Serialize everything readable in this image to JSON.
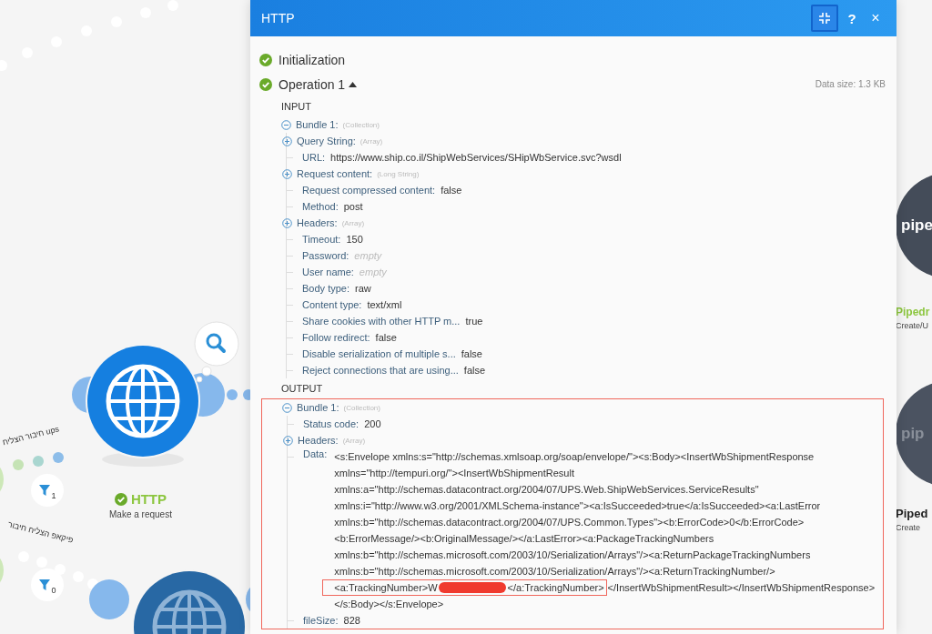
{
  "canvas": {
    "http_node": {
      "title": "HTTP",
      "subtitle": "Make a request",
      "ok": true
    },
    "filters": [
      {
        "count": "1",
        "label": "חיבור הצליח ups"
      },
      {
        "count": "0",
        "label": "פיקאפ הצליח חיבור"
      }
    ],
    "side_nodes": [
      {
        "logo": "pipe",
        "title": "Pipedr",
        "subtitle": "Create/U",
        "ok": true
      },
      {
        "logo": "pip",
        "title": "Piped",
        "subtitle": "Create",
        "ok": false
      }
    ]
  },
  "panel": {
    "title": "HTTP",
    "buttons": [
      {
        "kind": "shrink",
        "selected": true
      },
      {
        "kind": "help",
        "label": "?"
      },
      {
        "kind": "close",
        "label": "×"
      }
    ],
    "sections": [
      {
        "title": "Initialization",
        "ok": true
      },
      {
        "title": "Operation 1",
        "ok": true,
        "expanded": true,
        "data_size": "Data size: 1.3 KB",
        "groups": [
          {
            "title": "INPUT",
            "bundle": {
              "label": "Bundle 1:",
              "hint": "(Collection)",
              "expanded": true,
              "rows": [
                {
                  "kind": "expand",
                  "label": "Query String:",
                  "hint": "(Array)",
                  "expanded": false
                },
                {
                  "kind": "field",
                  "label": "URL:",
                  "value": "https://www.ship.co.il/ShipWebServices/SHipWbService.svc?wsdl"
                },
                {
                  "kind": "expand",
                  "label": "Request content:",
                  "hint": "(Long String)",
                  "expanded": false
                },
                {
                  "kind": "field",
                  "label": "Request compressed content:",
                  "value": "false"
                },
                {
                  "kind": "field",
                  "label": "Method:",
                  "value": "post"
                },
                {
                  "kind": "expand",
                  "label": "Headers:",
                  "hint": "(Array)",
                  "expanded": false
                },
                {
                  "kind": "field",
                  "label": "Timeout:",
                  "value": "150"
                },
                {
                  "kind": "field",
                  "label": "Password:",
                  "value": "empty",
                  "is_empty": true
                },
                {
                  "kind": "field",
                  "label": "User name:",
                  "value": "empty",
                  "is_empty": true
                },
                {
                  "kind": "field",
                  "label": "Body type:",
                  "value": "raw"
                },
                {
                  "kind": "field",
                  "label": "Content type:",
                  "value": "text/xml"
                },
                {
                  "kind": "field",
                  "label": "Share cookies with other HTTP m...",
                  "value": "true"
                },
                {
                  "kind": "field",
                  "label": "Follow redirect:",
                  "value": "false"
                },
                {
                  "kind": "field",
                  "label": "Disable serialization of multiple s...",
                  "value": "false"
                },
                {
                  "kind": "field",
                  "label": "Reject connections that are using...",
                  "value": "false"
                }
              ]
            }
          },
          {
            "title": "OUTPUT",
            "bundle": {
              "label": "Bundle 1:",
              "hint": "(Collection)",
              "expanded": true,
              "highlighted": true,
              "rows": [
                {
                  "kind": "field",
                  "label": "Status code:",
                  "value": "200"
                },
                {
                  "kind": "expand",
                  "label": "Headers:",
                  "hint": "(Array)",
                  "expanded": false
                },
                {
                  "kind": "multiline",
                  "label": "Data:",
                  "lines": [
                    {
                      "text": "<s:Envelope xmlns:s=\"http://schemas.xmlsoap.org/soap/envelope/\"><s:Body><InsertWbShipmentResponse"
                    },
                    {
                      "text": "xmlns=\"http://tempuri.org/\"><InsertWbShipmentResult"
                    },
                    {
                      "text": "xmlns:a=\"http://schemas.datacontract.org/2004/07/UPS.Web.ShipWebServices.ServiceResults\""
                    },
                    {
                      "text": "xmlns:i=\"http://www.w3.org/2001/XMLSchema-instance\"><a:IsSucceeded>true</a:IsSucceeded><a:LastError"
                    },
                    {
                      "text": "xmlns:b=\"http://schemas.datacontract.org/2004/07/UPS.Common.Types\"><b:ErrorCode>0</b:ErrorCode>"
                    },
                    {
                      "text": "<b:ErrorMessage/><b:OriginalMessage/></a:LastError><a:PackageTrackingNumbers"
                    },
                    {
                      "text": "xmlns:b=\"http://schemas.microsoft.com/2003/10/Serialization/Arrays\"/><a:ReturnPackageTrackingNumbers"
                    },
                    {
                      "text": "xmlns:b=\"http://schemas.microsoft.com/2003/10/Serialization/Arrays\"/><a:ReturnTrackingNumber/>"
                    },
                    {
                      "highlighted": true,
                      "before": "<a:TrackingNumber>W",
                      "redacted": true,
                      "after": "</a:TrackingNumber>",
                      "text": "</InsertWbShipmentResult></InsertWbShipmentResponse>"
                    },
                    {
                      "text": "</s:Body></s:Envelope>"
                    }
                  ]
                },
                {
                  "kind": "field",
                  "label": "fileSize:",
                  "value": "828"
                }
              ]
            }
          }
        ]
      }
    ]
  }
}
